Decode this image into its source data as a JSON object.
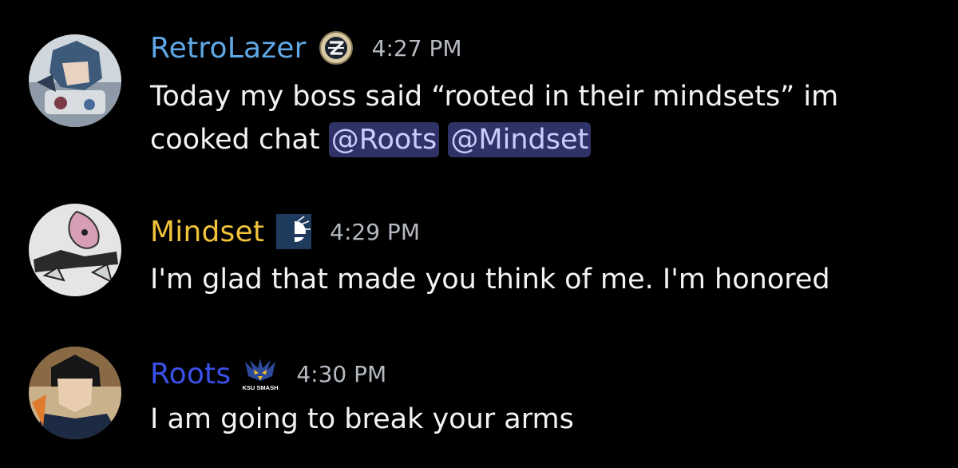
{
  "messages": [
    {
      "username": "RetroLazer",
      "username_color": "#5fa8e6",
      "role_icon": "z-badge-icon",
      "timestamp": "4:27 PM",
      "text_before": "Today my boss said “rooted in their mindsets” im cooked chat ",
      "mentions": [
        "@Roots",
        "@Mindset"
      ]
    },
    {
      "username": "Mindset",
      "username_color": "#f0c33a",
      "role_icon": "smash-logo-icon",
      "timestamp": "4:29 PM",
      "text": "I'm glad that made you think of me. I'm honored"
    },
    {
      "username": "Roots",
      "username_color": "#3b50e8",
      "role_icon": "ksu-smash-hawk-icon",
      "role_icon_text": "KSU SMASH",
      "timestamp": "4:30 PM",
      "text": "I am going to break your arms"
    }
  ],
  "colors": {
    "background": "#000000",
    "text": "#f2f3f5",
    "timestamp": "#b5bac1",
    "mention_bg": "#2f3266",
    "mention_text": "#c9cdfb"
  }
}
